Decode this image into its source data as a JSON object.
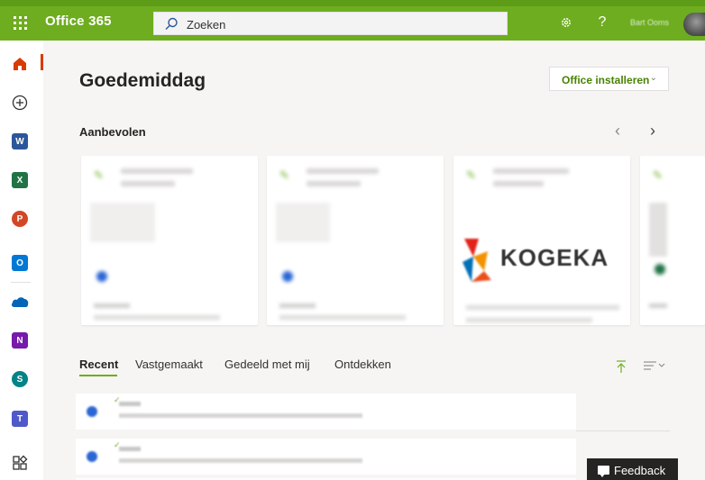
{
  "header": {
    "app_name": "Office 365",
    "search_placeholder": "Zoeken",
    "user_name": "Bart Ooms",
    "icons": [
      "app-launcher-icon",
      "search-icon",
      "gear-icon",
      "help-icon"
    ],
    "accent_color": "#6dad1f"
  },
  "rail": {
    "items": [
      {
        "name": "home",
        "icon": "home-icon",
        "color": "#d83b01"
      },
      {
        "name": "create",
        "icon": "plus-circle-icon",
        "color": "#323130"
      },
      {
        "name": "word",
        "icon": "word-icon",
        "color": "#2b579a",
        "letter": "W"
      },
      {
        "name": "excel",
        "icon": "excel-icon",
        "color": "#217346",
        "letter": "X"
      },
      {
        "name": "powerpoint",
        "icon": "powerpoint-icon",
        "color": "#d24726",
        "letter": "P"
      },
      {
        "name": "outlook",
        "icon": "outlook-icon",
        "color": "#0078d4",
        "letter": "O"
      },
      {
        "name": "onedrive",
        "icon": "onedrive-icon",
        "color": "#0364b8"
      },
      {
        "name": "onenote",
        "icon": "onenote-icon",
        "color": "#7719aa",
        "letter": "N"
      },
      {
        "name": "sharepoint",
        "icon": "sharepoint-icon",
        "color": "#038387",
        "letter": "S"
      },
      {
        "name": "teams",
        "icon": "teams-icon",
        "color": "#5059c9",
        "letter": "T"
      },
      {
        "name": "all-apps",
        "icon": "all-apps-icon",
        "color": "#323130"
      }
    ]
  },
  "main": {
    "greeting": "Goedemiddag",
    "install_button": "Office installeren",
    "recommended_title": "Aanbevolen",
    "cards": [
      {
        "logo_text": ""
      },
      {
        "logo_text": ""
      },
      {
        "logo_text": "KOGEKA"
      },
      {
        "logo_text": ""
      }
    ],
    "tabs": [
      "Recent",
      "Vastgemaakt",
      "Gedeeld met mij",
      "Ontdekken"
    ],
    "active_tab": "Recent"
  },
  "feedback_button": "Feedback"
}
